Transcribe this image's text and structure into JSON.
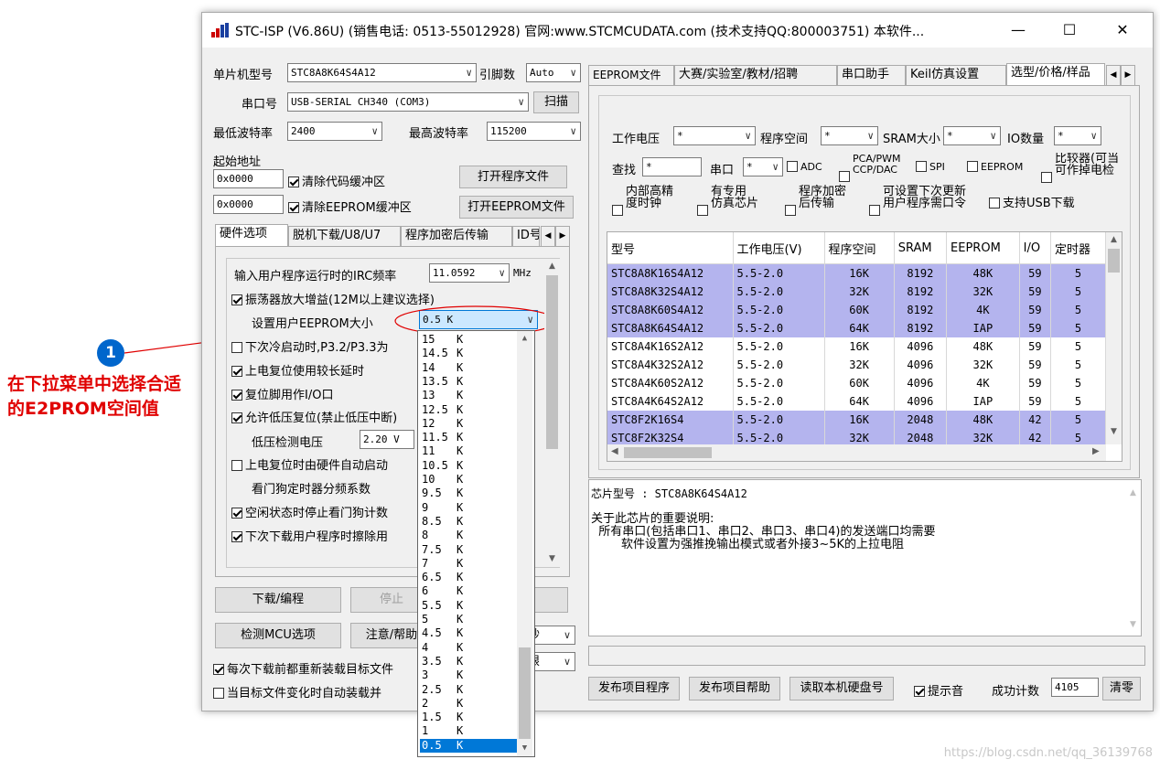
{
  "window": {
    "title": "STC-ISP (V6.86U) (销售电话: 0513-55012928) 官网:www.STCMCUDATA.com  (技术支持QQ:800003751) 本软件...",
    "min": "—",
    "max": "☐",
    "close": "✕"
  },
  "left": {
    "mcu_label": "单片机型号",
    "mcu_value": "STC8A8K64S4A12",
    "pins_label": "引脚数",
    "pins_value": "Auto",
    "port_label": "串口号",
    "port_value": "USB-SERIAL CH340 (COM3)",
    "scan_button": "扫描",
    "min_baud_label": "最低波特率",
    "min_baud_value": "2400",
    "max_baud_label": "最高波特率",
    "max_baud_value": "115200",
    "start_addr_label": "起始地址",
    "addr1": "0x0000",
    "clear_code_label": "清除代码缓冲区",
    "open_prog_button": "打开程序文件",
    "addr2": "0x0000",
    "clear_eeprom_label": "清除EEPROM缓冲区",
    "open_eeprom_button": "打开EEPROM文件",
    "tabs": [
      "硬件选项",
      "脱机下载/U8/U7",
      "程序加密后传输",
      "ID号"
    ],
    "hw": {
      "irc_label": "输入用户程序运行时的IRC频率",
      "irc_value": "11.0592",
      "irc_unit": "MHz",
      "osc_gain_label": "振荡器放大增益(12M以上建议选择)",
      "eeprom_size_label": "设置用户EEPROM大小",
      "eeprom_size_value": "0.5 K",
      "cold_boot_label": "下次冷启动时,P3.2/P3.3为",
      "power_delay_label": "上电复位使用较长延时",
      "reset_pin_label": "复位脚用作I/O口",
      "low_volt_label": "允许低压复位(禁止低压中断)",
      "low_volt_detect_label": "低压检测电压",
      "low_volt_value": "2.20 V",
      "hw_watchdog_label": "上电复位时由硬件自动启动",
      "watchdog_div_label": "看门狗定时器分频系数",
      "idle_stop_label": "空闲状态时停止看门狗计数",
      "erase_label": "下次下载用户程序时擦除用"
    },
    "download_button": "下载/编程",
    "stop_button": "停止",
    "detect_button": "检测MCU选项",
    "help_button": "注意/帮助",
    "delay_suffix": "秒",
    "limit_suffix": "限",
    "reload_label": "每次下载前都重新装载目标文件",
    "auto_load_label": "当目标文件变化时自动装载并"
  },
  "dropdown": {
    "items": [
      {
        "num": "15",
        "unit": "K"
      },
      {
        "num": "14.5",
        "unit": "K"
      },
      {
        "num": "14",
        "unit": "K"
      },
      {
        "num": "13.5",
        "unit": "K"
      },
      {
        "num": "13",
        "unit": "K"
      },
      {
        "num": "12.5",
        "unit": "K"
      },
      {
        "num": "12",
        "unit": "K"
      },
      {
        "num": "11.5",
        "unit": "K"
      },
      {
        "num": "11",
        "unit": "K"
      },
      {
        "num": "10.5",
        "unit": "K"
      },
      {
        "num": "10",
        "unit": "K"
      },
      {
        "num": "9.5",
        "unit": "K"
      },
      {
        "num": "9",
        "unit": "K"
      },
      {
        "num": "8.5",
        "unit": "K"
      },
      {
        "num": "8",
        "unit": "K"
      },
      {
        "num": "7.5",
        "unit": "K"
      },
      {
        "num": "7",
        "unit": "K"
      },
      {
        "num": "6.5",
        "unit": "K"
      },
      {
        "num": "6",
        "unit": "K"
      },
      {
        "num": "5.5",
        "unit": "K"
      },
      {
        "num": "5",
        "unit": "K"
      },
      {
        "num": "4.5",
        "unit": "K"
      },
      {
        "num": "4",
        "unit": "K"
      },
      {
        "num": "3.5",
        "unit": "K"
      },
      {
        "num": "3",
        "unit": "K"
      },
      {
        "num": "2.5",
        "unit": "K"
      },
      {
        "num": "2",
        "unit": "K"
      },
      {
        "num": "1.5",
        "unit": "K"
      },
      {
        "num": "1",
        "unit": "K"
      },
      {
        "num": "0.5",
        "unit": "K"
      }
    ],
    "selected_index": 29
  },
  "right": {
    "tabs": [
      "EEPROM文件",
      "大赛/实验室/教材/招聘",
      "串口助手",
      "Keil仿真设置",
      "选型/价格/样品"
    ],
    "filter": {
      "voltage_label": "工作电压",
      "voltage_value": "*",
      "prog_space_label": "程序空间",
      "prog_space_value": "*",
      "sram_label": "SRAM大小",
      "sram_value": "*",
      "io_label": "IO数量",
      "io_value": "*",
      "search_label": "查找",
      "search_value": "*",
      "uart_label": "串口",
      "uart_value": "*",
      "adc_label": "ADC",
      "pca_label": "PCA/PWM\nCCP/DAC",
      "spi_label": "SPI",
      "eeprom_label": "EEPROM",
      "comparator_label": "比较器(可当\n可作掉电检",
      "hp_clock_label": "内部高精\n度时钟",
      "emu_chip_label": "有专用\n仿真芯片",
      "enc_label": "程序加密\n后传输",
      "next_update_label": "可设置下次更新\n用户程序需口令",
      "usb_label": "支持USB下载"
    },
    "table": {
      "headers": [
        "型号",
        "工作电压(V)",
        "程序空间",
        "SRAM",
        "EEPROM",
        "I/O",
        "定时器"
      ],
      "rows": [
        {
          "c": [
            "STC8A8K16S4A12",
            "5.5-2.0",
            "16K",
            "8192",
            "48K",
            "59",
            "5"
          ],
          "sel": true
        },
        {
          "c": [
            "STC8A8K32S4A12",
            "5.5-2.0",
            "32K",
            "8192",
            "32K",
            "59",
            "5"
          ],
          "sel": true
        },
        {
          "c": [
            "STC8A8K60S4A12",
            "5.5-2.0",
            "60K",
            "8192",
            "4K",
            "59",
            "5"
          ],
          "sel": true
        },
        {
          "c": [
            "STC8A8K64S4A12",
            "5.5-2.0",
            "64K",
            "8192",
            "IAP",
            "59",
            "5"
          ],
          "sel": true
        },
        {
          "c": [
            "STC8A4K16S2A12",
            "5.5-2.0",
            "16K",
            "4096",
            "48K",
            "59",
            "5"
          ],
          "sel": false
        },
        {
          "c": [
            "STC8A4K32S2A12",
            "5.5-2.0",
            "32K",
            "4096",
            "32K",
            "59",
            "5"
          ],
          "sel": false
        },
        {
          "c": [
            "STC8A4K60S2A12",
            "5.5-2.0",
            "60K",
            "4096",
            "4K",
            "59",
            "5"
          ],
          "sel": false
        },
        {
          "c": [
            "STC8A4K64S2A12",
            "5.5-2.0",
            "64K",
            "4096",
            "IAP",
            "59",
            "5"
          ],
          "sel": false
        },
        {
          "c": [
            "STC8F2K16S4",
            "5.5-2.0",
            "16K",
            "2048",
            "48K",
            "42",
            "5"
          ],
          "sel": true
        },
        {
          "c": [
            "STC8F2K32S4",
            "5.5-2.0",
            "32K",
            "2048",
            "32K",
            "42",
            "5"
          ],
          "sel": true
        }
      ]
    },
    "info": {
      "chip_label": "芯片型号 : STC8A8K64S4A12",
      "note_title": "关于此芯片的重要说明:",
      "note_line1": "  所有串口(包括串口1、串口2、串口3、串口4)的发送端口均需要",
      "note_line2": "        软件设置为强推挽输出模式或者外接3~5K的上拉电阻"
    },
    "publish_button": "发布项目程序",
    "publish_help_button": "发布项目帮助",
    "read_disk_button": "读取本机硬盘号",
    "beep_label": "提示音",
    "success_label": "成功计数",
    "success_value": "4105",
    "clear_button": "清零"
  },
  "annotation": {
    "number": "1",
    "line1": "在下拉菜单中选择合适",
    "line2": "的E2PROM空间值",
    "color": "#e00000"
  },
  "watermark": "https://blog.csdn.net/qq_36139768"
}
